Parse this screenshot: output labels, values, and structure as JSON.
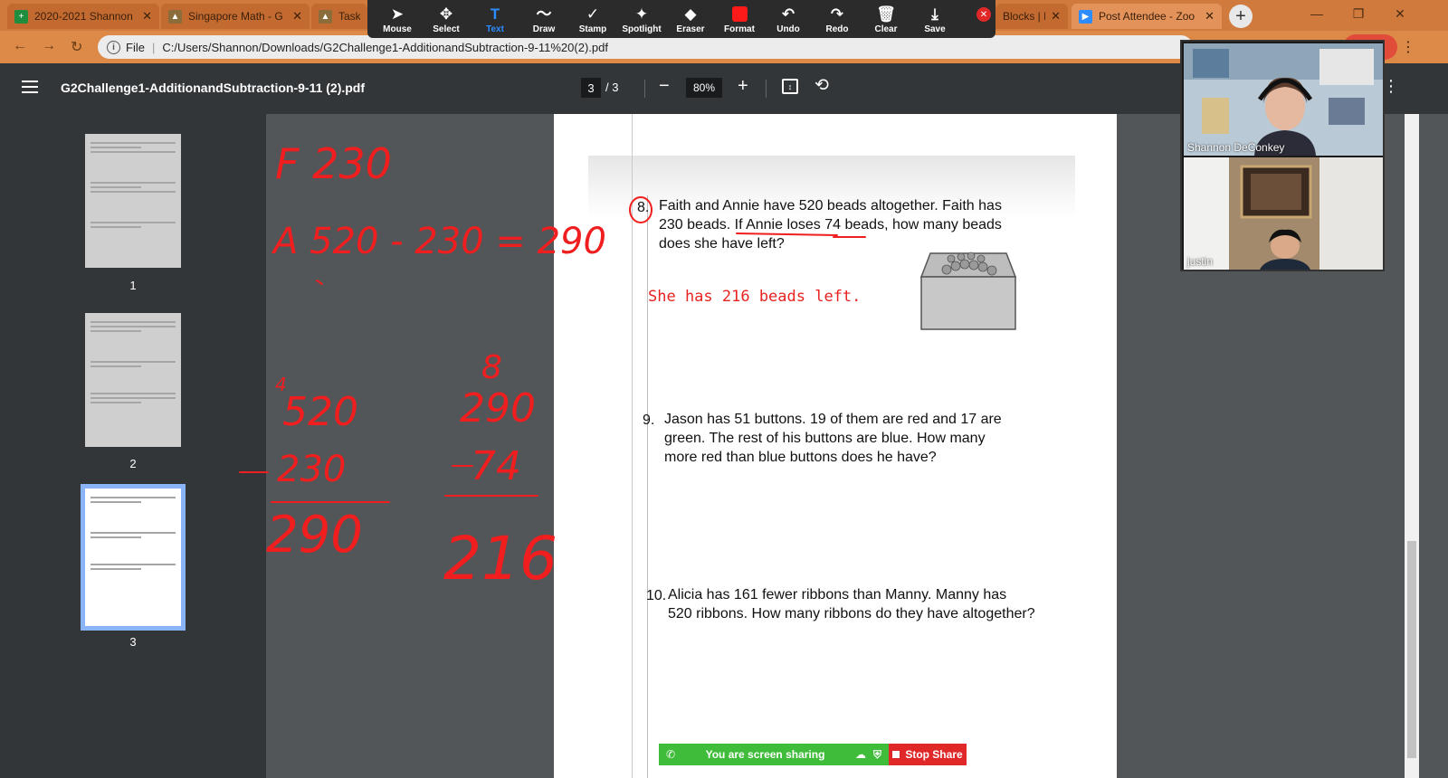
{
  "browser": {
    "tabs": [
      {
        "title": "2020-2021 Shannon",
        "color": "#1e8e3e"
      },
      {
        "title": "Singapore Math - G",
        "color": "#8a6d3b"
      },
      {
        "title": "Task",
        "color": "#8a6d3b"
      },
      {
        "title": "Blocks | Ma",
        "color": "#4285f4"
      },
      {
        "title": "Post Attendee - Zoo",
        "color": "#2d8cff"
      }
    ],
    "address": {
      "scheme_label": "File",
      "url": "C:/Users/Shannon/Downloads/G2Challenge1-AdditionandSubtraction-9-11%20(2).pdf"
    }
  },
  "annotate_toolbar": {
    "tools": [
      {
        "label": "Mouse",
        "icon": "mouse-pointer-icon",
        "glyph": "➤"
      },
      {
        "label": "Select",
        "icon": "move-icon",
        "glyph": "✥"
      },
      {
        "label": "Text",
        "icon": "text-icon",
        "glyph": "T"
      },
      {
        "label": "Draw",
        "icon": "draw-icon",
        "glyph": "〜"
      },
      {
        "label": "Stamp",
        "icon": "stamp-icon",
        "glyph": "✓"
      },
      {
        "label": "Spotlight",
        "icon": "spotlight-icon",
        "glyph": "✦"
      },
      {
        "label": "Eraser",
        "icon": "eraser-icon",
        "glyph": "◆"
      },
      {
        "label": "Format",
        "icon": "format-icon",
        "glyph": "■"
      },
      {
        "label": "Undo",
        "icon": "undo-icon",
        "glyph": "↶"
      },
      {
        "label": "Redo",
        "icon": "redo-icon",
        "glyph": "↷"
      },
      {
        "label": "Clear",
        "icon": "trash-icon",
        "glyph": "🗑"
      },
      {
        "label": "Save",
        "icon": "save-icon",
        "glyph": "⤓"
      }
    ],
    "active_tool": "Text",
    "format_color": "#ff1a1a"
  },
  "pdf_viewer": {
    "title": "G2Challenge1-AdditionandSubtraction-9-11 (2).pdf",
    "current_page": "3",
    "total_pages": "/ 3",
    "zoom": "80%",
    "thumbnails": [
      "1",
      "2",
      "3"
    ]
  },
  "document": {
    "q8": {
      "number": "8.",
      "lines": [
        "Faith and Annie have 520 beads altogether. Faith has",
        "230 beads. If Annie loses 74 beads, how many beads",
        "does she have left?"
      ]
    },
    "q8_answer": "She has 216 beads left.",
    "q9": {
      "number": "9.",
      "lines": [
        "Jason has 51 buttons. 19 of them are red and 17 are",
        "green. The rest of his buttons are blue. How many",
        "more red than blue buttons does he have?"
      ]
    },
    "q10": {
      "number": "10.",
      "lines": [
        "Alicia has 161 fewer ribbons than Manny. Manny has",
        "520 ribbons. How many ribbons do they have altogether?"
      ]
    }
  },
  "handwriting": {
    "color": "#f01e1e",
    "line1": "F 230",
    "line2": "A 520 - 230 = 290",
    "calc1": {
      "top": "520",
      "carry": "4",
      "sub": "230",
      "result": "290"
    },
    "calc2": {
      "top": "290",
      "carry": "8",
      "sub": "74",
      "result": "216"
    }
  },
  "video": {
    "participants": [
      {
        "name": "Shannon DeConkey"
      },
      {
        "name": "justin"
      }
    ]
  },
  "share_bar": {
    "status": "You are screen sharing",
    "stop_label": "Stop Share",
    "sharing_color": "#3fbd3a",
    "stop_color": "#e02828"
  }
}
